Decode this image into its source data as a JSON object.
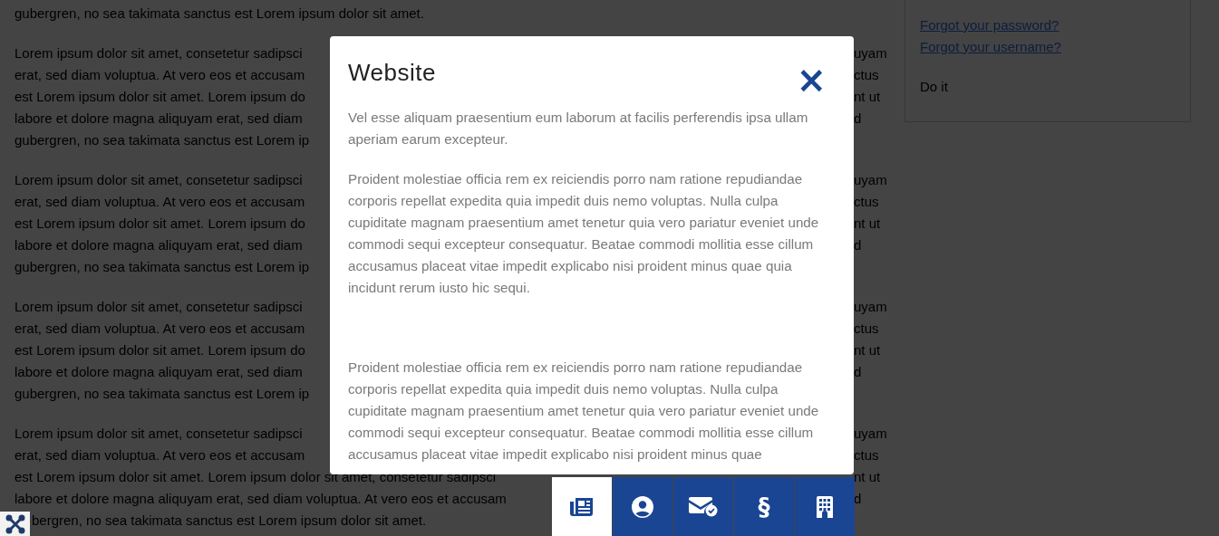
{
  "page": {
    "paragraphs": [
      {
        "lines": [
          {
            "left": "gubergren, no sea takimata sanctus est Lorem ipsum dolor sit amet."
          }
        ]
      },
      {
        "lines": [
          {
            "left": "Lorem ipsum dolor sit amet, consetetur sadipsci",
            "right": "uyam"
          },
          {
            "left": "erat, sed diam voluptua. At vero eos et accusam",
            "right": "ctus"
          },
          {
            "left": "est Lorem ipsum dolor sit amet. Lorem ipsum do",
            "right": "nt ut"
          },
          {
            "left": "labore et dolore magna aliquyam erat, sed diam",
            "right": "d"
          },
          {
            "left": "gubergren, no sea takimata sanctus est Lorem ip"
          }
        ]
      },
      {
        "lines": [
          {
            "left": "Lorem ipsum dolor sit amet, consetetur sadipsci",
            "right": "uyam"
          },
          {
            "left": "erat, sed diam voluptua. At vero eos et accusam",
            "right": "ctus"
          },
          {
            "left": "est Lorem ipsum dolor sit amet. Lorem ipsum do",
            "right": "nt ut"
          },
          {
            "left": "labore et dolore magna aliquyam erat, sed diam",
            "right": "d"
          },
          {
            "left": "gubergren, no sea takimata sanctus est Lorem ip"
          }
        ]
      },
      {
        "lines": [
          {
            "left": "Lorem ipsum dolor sit amet, consetetur sadipsci",
            "right": "uyam"
          },
          {
            "left": "erat, sed diam voluptua. At vero eos et accusam",
            "right": "ctus"
          },
          {
            "left": "est Lorem ipsum dolor sit amet. Lorem ipsum do",
            "right": "nt ut"
          },
          {
            "left": "labore et dolore magna aliquyam erat, sed diam",
            "right": "d"
          },
          {
            "left": "gubergren, no sea takimata sanctus est Lorem ip"
          }
        ]
      },
      {
        "lines": [
          {
            "left": "Lorem ipsum dolor sit amet, consetetur sadipsci",
            "right": "uyam"
          },
          {
            "left": "erat, sed diam voluptua. At vero eos et accusam",
            "right": "ctus"
          },
          {
            "left": "est Lorem ipsum dolor sit amet. Lorem ipsum dolor sit amet, consetetur sadipsci",
            "right": "nt ut"
          },
          {
            "left": "labore et dolore magna aliquyam erat, sed diam voluptua. At vero eos et accusam",
            "right": "d"
          },
          {
            "left": "bergren, no sea takimata sanctus est Lorem ipsum dolor sit amet."
          }
        ]
      }
    ],
    "login_panel": {
      "links": [
        "Forgot your password?",
        "Forgot your username?"
      ],
      "button": "Do it"
    }
  },
  "modal": {
    "title": "Website",
    "close": "×",
    "paragraphs": [
      "Vel esse aliquam praesentium eum laborum at facilis perferendis ipsa ullam aperiam earum excepteur.",
      "Proident molestiae officia rem ex reiciendis porro nam ratione repudiandae corporis repellat expedita quia impedit duis nemo voluptas. Nulla culpa cupiditate magnam praesentium amet tenetur quia vero pariatur eveniet unde commodi sequi excepteur consequatur. Beatae commodi mollitia esse cillum accusamus placeat vitae impedit explicabo nisi proident minus quae quia incidunt rerum iusto hic sequi.",
      "Proident molestiae officia rem ex reiciendis porro nam ratione repudiandae corporis repellat expedita quia impedit duis nemo voluptas. Nulla culpa cupiditate magnam praesentium amet tenetur quia vero pariatur eveniet unde commodi sequi excepteur consequatur. Beatae commodi mollitia esse cillum accusamus placeat vitae impedit explicabo nisi proident minus quae"
    ]
  },
  "tabs": [
    {
      "selected": true
    },
    {
      "selected": false
    },
    {
      "selected": false
    },
    {
      "selected": false,
      "glyph": "§"
    },
    {
      "selected": false
    }
  ]
}
